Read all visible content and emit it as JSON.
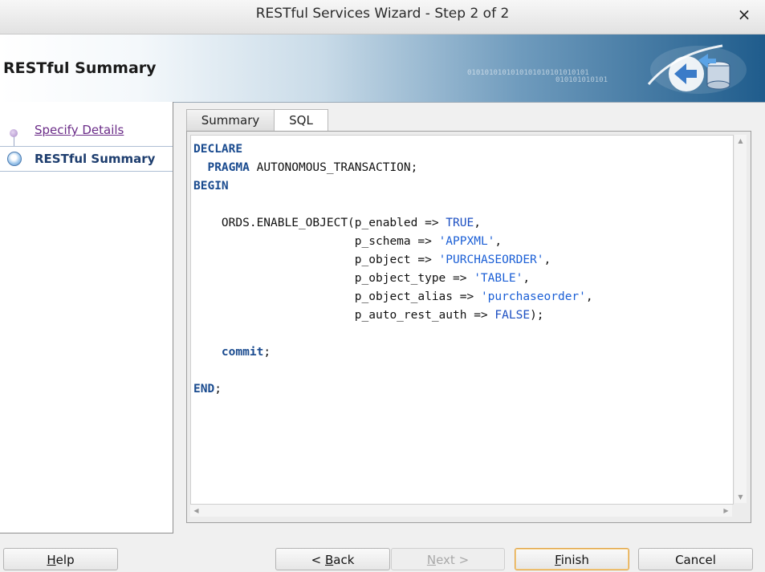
{
  "window": {
    "title": "RESTful Services Wizard - Step 2 of 2",
    "close_glyph": "×"
  },
  "banner": {
    "heading": "RESTful Summary",
    "binary_text_1": "0101010101010101010101010101",
    "binary_text_2": "010101010101"
  },
  "nav": {
    "steps": [
      {
        "label": "Specify Details",
        "state": "visited"
      },
      {
        "label": "RESTful Summary",
        "state": "current"
      }
    ]
  },
  "tabs": [
    {
      "label": "Summary",
      "selected": false
    },
    {
      "label": "SQL",
      "selected": true
    }
  ],
  "sql": {
    "l1": "DECLARE",
    "l2_kw": "PRAGMA",
    "l2_rest": " AUTONOMOUS_TRANSACTION;",
    "l3": "BEGIN",
    "l5_a": "ORDS.ENABLE_OBJECT(p_enabled => ",
    "l5_v": "TRUE",
    "l5_e": ",",
    "l6_a": "p_schema => ",
    "l6_v": "'APPXML'",
    "l6_e": ",",
    "l7_a": "p_object => ",
    "l7_v": "'PURCHASEORDER'",
    "l7_e": ",",
    "l8_a": "p_object_type => ",
    "l8_v": "'TABLE'",
    "l8_e": ",",
    "l9_a": "p_object_alias => ",
    "l9_v": "'purchaseorder'",
    "l9_e": ",",
    "l10_a": "p_auto_rest_auth => ",
    "l10_v": "FALSE",
    "l10_e": ");",
    "l12_kw": "commit",
    "l12_e": ";",
    "l14_kw": "END",
    "l14_e": ";"
  },
  "buttons": {
    "help_mn": "H",
    "help_rest": "elp",
    "back_pre": "< ",
    "back_mn": "B",
    "back_rest": "ack",
    "next_mn": "N",
    "next_rest": "ext >",
    "finish_mn": "F",
    "finish_rest": "inish",
    "cancel": "Cancel"
  },
  "colors": {
    "accent": "#1a4b8f",
    "visited_link": "#6b2c88",
    "focus_border": "#e0a44a"
  }
}
